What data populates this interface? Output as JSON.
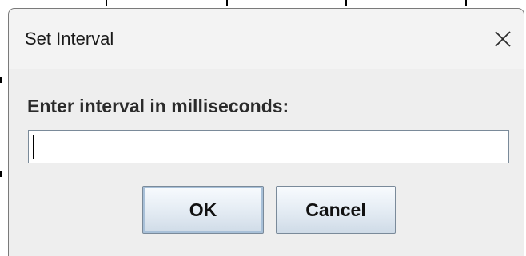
{
  "dialog": {
    "title": "Set Interval",
    "close_icon": "close-icon",
    "prompt": "Enter interval in milliseconds:",
    "input_value": "",
    "ok_label": "OK",
    "cancel_label": "Cancel"
  }
}
